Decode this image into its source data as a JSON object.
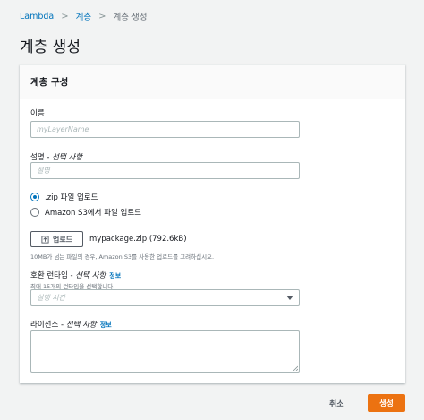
{
  "breadcrumb": {
    "items": [
      "Lambda",
      "계층",
      "계층 생성"
    ],
    "separator": ">"
  },
  "page": {
    "title": "계층 생성"
  },
  "panel": {
    "title": "계층 구성",
    "name_field": {
      "label": "이름",
      "placeholder": "myLayerName",
      "value": ""
    },
    "description_field": {
      "label_main": "설명 - ",
      "label_optional": "선택 사항",
      "placeholder": "설명",
      "value": ""
    },
    "upload_options": [
      {
        "label": ".zip 파일 업로드",
        "selected": true
      },
      {
        "label": "Amazon S3에서 파일 업로드",
        "selected": false
      }
    ],
    "upload": {
      "button_label": "업로드",
      "icon": "upload-icon",
      "file_name": "mypackage.zip (792.6kB)",
      "hint": "10MB가 넘는 파일의 경우, Amazon S3를 사용한 업로드를 고려하십시오."
    },
    "runtimes": {
      "label_main": "호환 런타임 - ",
      "label_optional": "선택 사항",
      "info": "정보",
      "hint": "최대 15개의 런타임을 선택합니다.",
      "placeholder": "실행 시간"
    },
    "license": {
      "label_main": "라이선스 - ",
      "label_optional": "선택 사항",
      "info": "정보",
      "value": ""
    }
  },
  "footer": {
    "cancel_label": "취소",
    "create_label": "생성"
  },
  "colors": {
    "accent": "#ec7211",
    "link": "#0073bb",
    "background": "#f2f3f3"
  }
}
